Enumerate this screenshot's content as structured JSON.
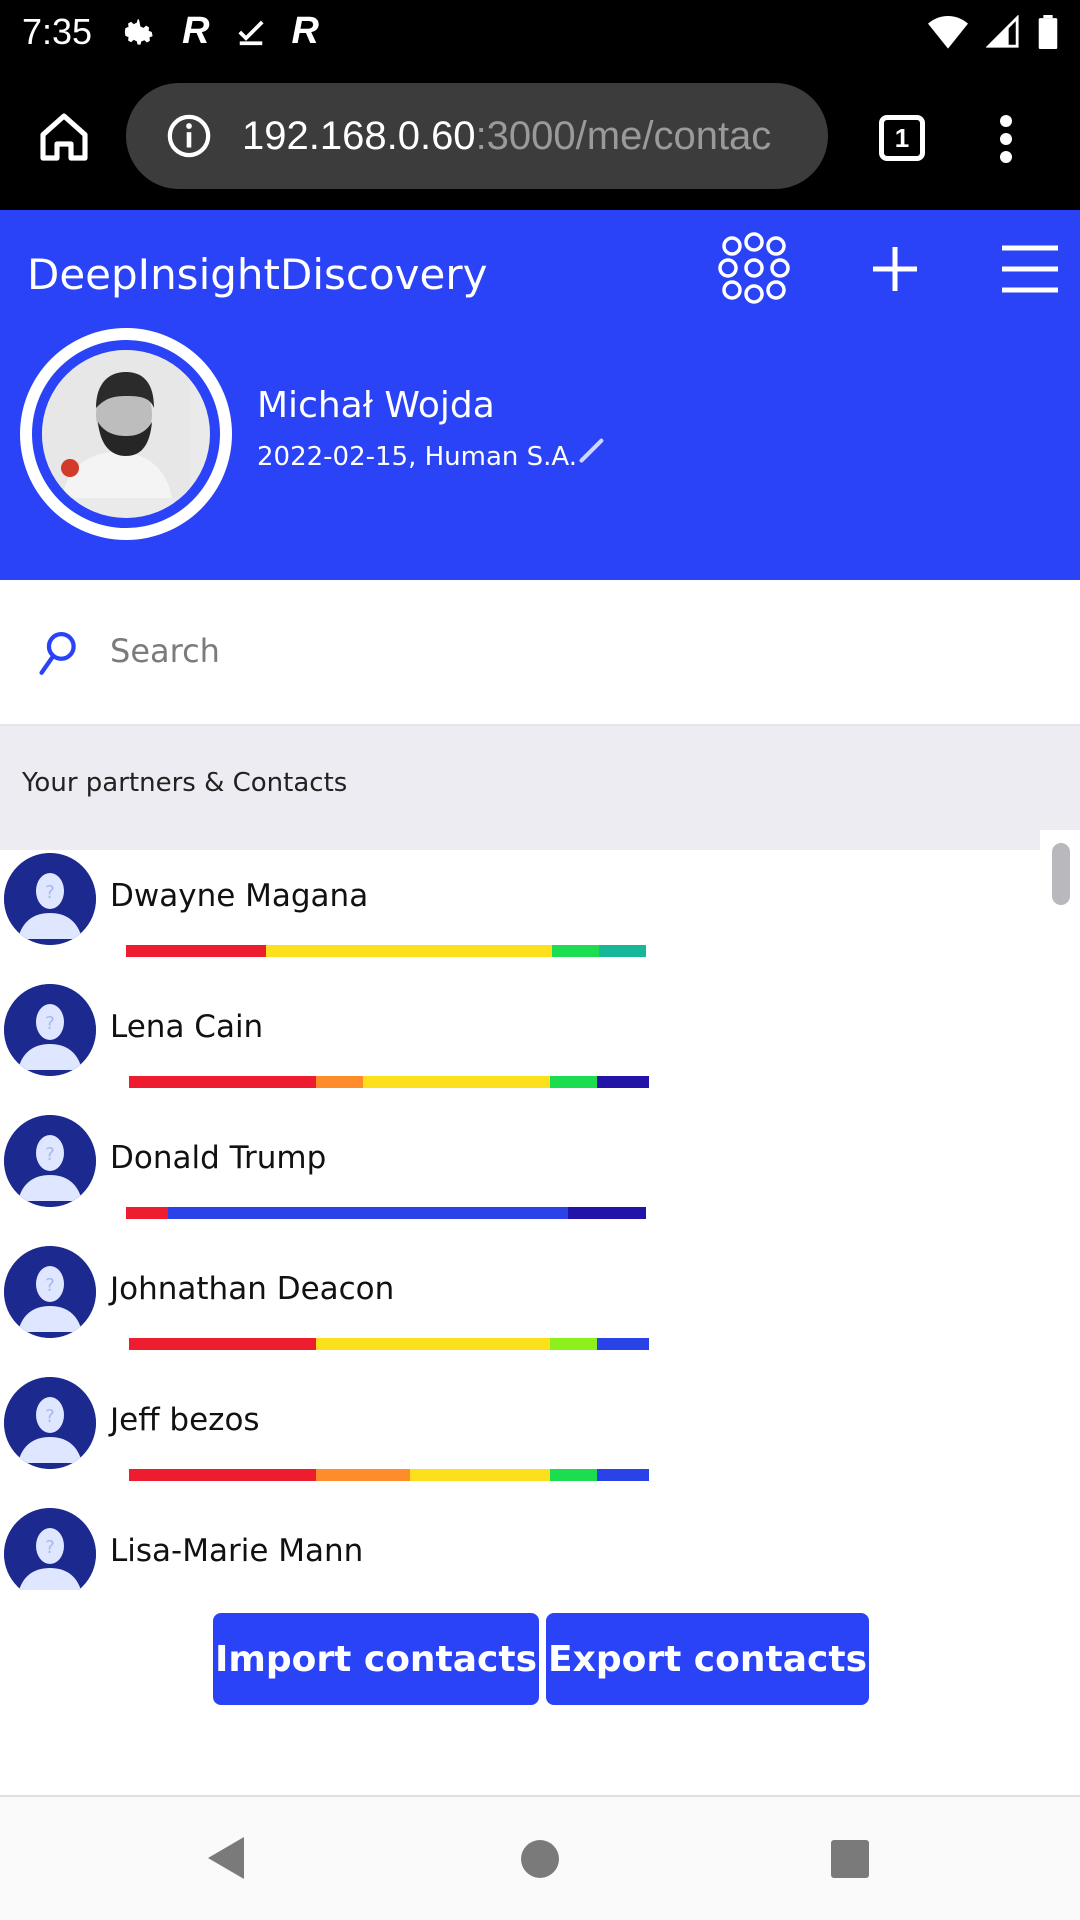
{
  "status_bar": {
    "time": "7:35",
    "left_icons": [
      "gear-icon",
      "r-app-icon",
      "check-icon",
      "r-app-icon"
    ],
    "right_icons": [
      "wifi-icon",
      "signal-icon",
      "battery-icon"
    ]
  },
  "browser": {
    "url_host": "192.168.0.60",
    "url_rest": ":3000/me/contac",
    "tab_count": "1"
  },
  "app": {
    "brand": "DeepInsightDiscovery",
    "accent": "#2a43f6"
  },
  "profile": {
    "name": "Michał Wojda",
    "subtitle": "2022-02-15, Human S.A."
  },
  "search": {
    "placeholder": "Search"
  },
  "section_title": "Your partners & Contacts",
  "contacts": [
    {
      "name": "Dwayne Magana",
      "bar": [
        [
          "#ed1c2e",
          27
        ],
        [
          "#fce01c",
          55
        ],
        [
          "#1cdd4f",
          9
        ],
        [
          "#17b89a",
          9
        ]
      ]
    },
    {
      "name": "Lena Cain",
      "bar": [
        [
          "#ed1c2e",
          36
        ],
        [
          "#ff8c2a",
          9
        ],
        [
          "#fce01c",
          36
        ],
        [
          "#1cdd4f",
          9
        ],
        [
          "#2314a8",
          10
        ]
      ]
    },
    {
      "name": "Donald Trump",
      "bar": [
        [
          "#ed1c2e",
          8
        ],
        [
          "#2a43e8",
          77
        ],
        [
          "#2314a8",
          15
        ]
      ]
    },
    {
      "name": "Johnathan Deacon",
      "bar": [
        [
          "#ed1c2e",
          36
        ],
        [
          "#fce01c",
          45
        ],
        [
          "#8ef01a",
          9
        ],
        [
          "#2a43e8",
          10
        ]
      ]
    },
    {
      "name": "Jeff bezos",
      "bar": [
        [
          "#ed1c2e",
          36
        ],
        [
          "#ff8c2a",
          18
        ],
        [
          "#fce01c",
          27
        ],
        [
          "#1cdd4f",
          9
        ],
        [
          "#2a43e8",
          10
        ]
      ]
    },
    {
      "name": "Lisa-Marie Mann",
      "bar": []
    }
  ],
  "buttons": {
    "import_label": "Import contacts",
    "export_label": "Export contacts"
  }
}
